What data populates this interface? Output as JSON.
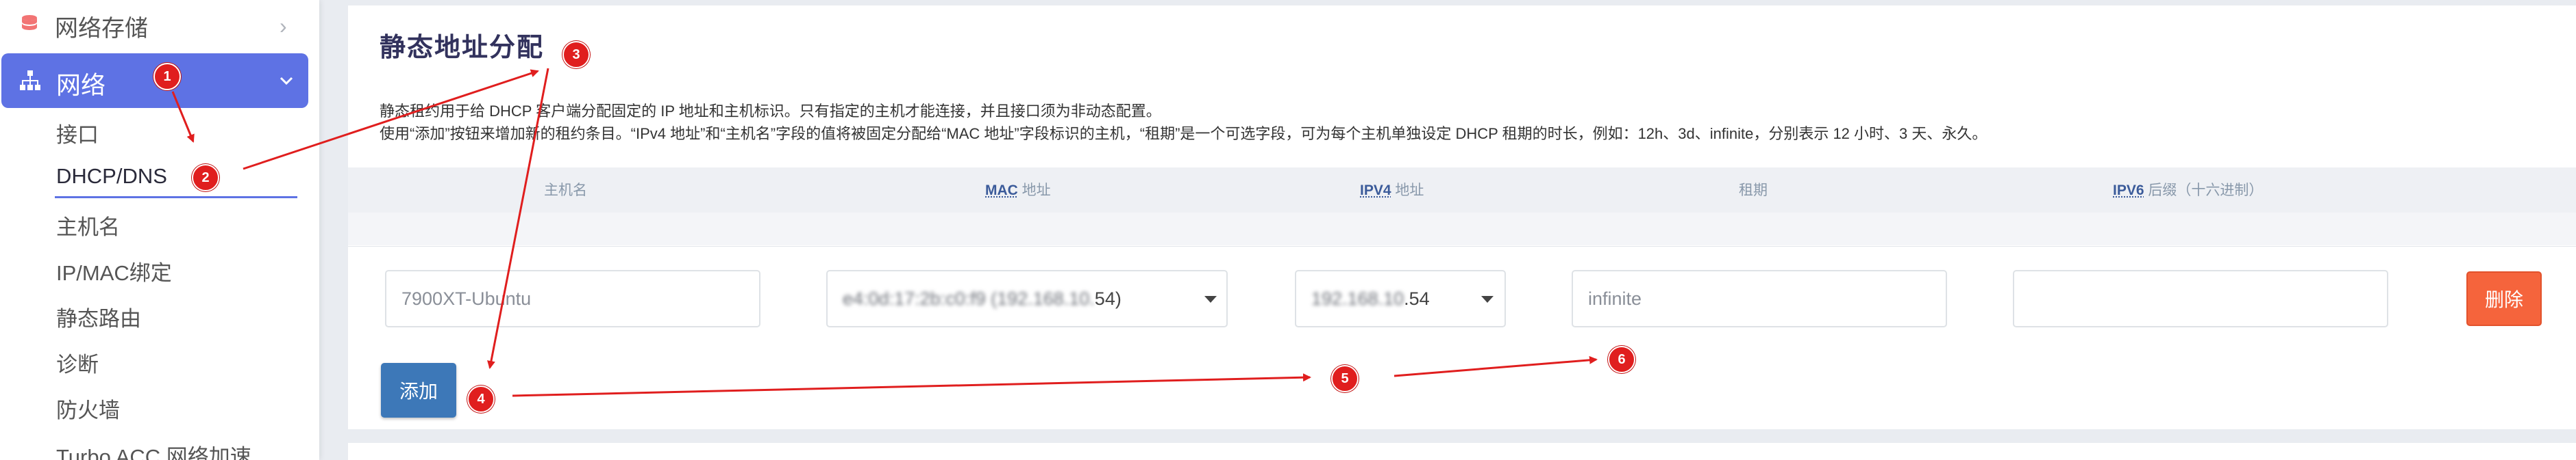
{
  "sidebar": {
    "storage_label": "网络存储",
    "network_label": "网络",
    "items": [
      {
        "label": "接口"
      },
      {
        "label": "DHCP/DNS"
      },
      {
        "label": "主机名"
      },
      {
        "label": "IP/MAC绑定"
      },
      {
        "label": "静态路由"
      },
      {
        "label": "诊断"
      },
      {
        "label": "防火墙"
      },
      {
        "label": "Turbo ACC 网络加速"
      }
    ]
  },
  "main": {
    "title": "静态地址分配",
    "desc_line1": "静态租约用于给 DHCP 客户端分配固定的 IP 地址和主机标识。只有指定的主机才能连接，并且接口须为非动态配置。",
    "desc_line2": "使用“添加”按钮来增加新的租约条目。“IPv4 地址”和“主机名”字段的值将被固定分配给“MAC 地址”字段标识的主机，“租期”是一个可选字段，可为每个主机单独设定 DHCP 租期的时长，例如：12h、3d、infinite，分别表示 12 小时、3 天、永久。",
    "columns": {
      "hostname": "主机名",
      "mac_abbr": "MAC",
      "mac_rest": "地址",
      "ipv4_abbr": "IPV4",
      "ipv4_rest": "地址",
      "lease": "租期",
      "ipv6_abbr": "IPV6",
      "ipv6_rest": "后缀（十六进制）"
    },
    "row": {
      "hostname": "7900XT-Ubuntu",
      "mac_blurred": "e4:0d:17:2b:c0:f9 (192.168.10.",
      "mac_suffix": "54)",
      "ipv4_blurred": "192.168.10",
      "ipv4_suffix": ".54",
      "lease": "infinite",
      "ipv6": "",
      "delete_label": "删除"
    },
    "add_label": "添加"
  },
  "annotations": [
    "1",
    "2",
    "3",
    "4",
    "5",
    "6"
  ],
  "colors": {
    "accent": "#5e72e4",
    "delete": "#f5643c",
    "add": "#3d78b8",
    "annotation": "#e01e1e"
  }
}
